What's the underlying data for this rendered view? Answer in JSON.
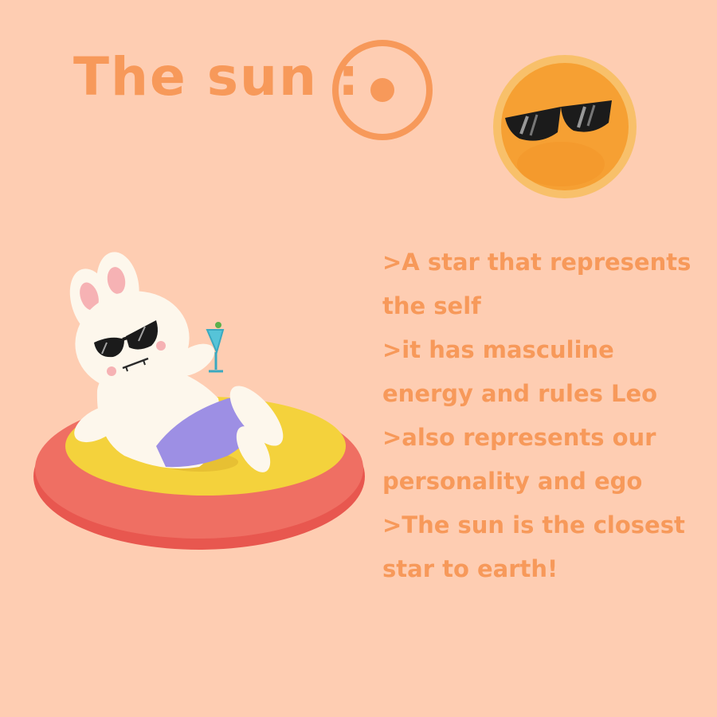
{
  "title": "The sun :",
  "icons": {
    "sun_symbol": "sun-astrological-symbol-icon",
    "cool_sun": "sun-with-sunglasses-icon",
    "illustration": "bunny-on-pool-float-illustration"
  },
  "facts": [
    ">A star that represents the self",
    ">it has masculine energy and rules Leo",
    ">also represents our personality and ego",
    ">The sun is the closest star to earth!"
  ],
  "colors": {
    "background": "#fecdb2",
    "text": "#f7995a",
    "sun_fill": "#f6a033",
    "float_red": "#ef6f63",
    "float_yellow": "#f4d23c",
    "shorts": "#9d8fe4",
    "bunny": "#fdf7ec"
  }
}
